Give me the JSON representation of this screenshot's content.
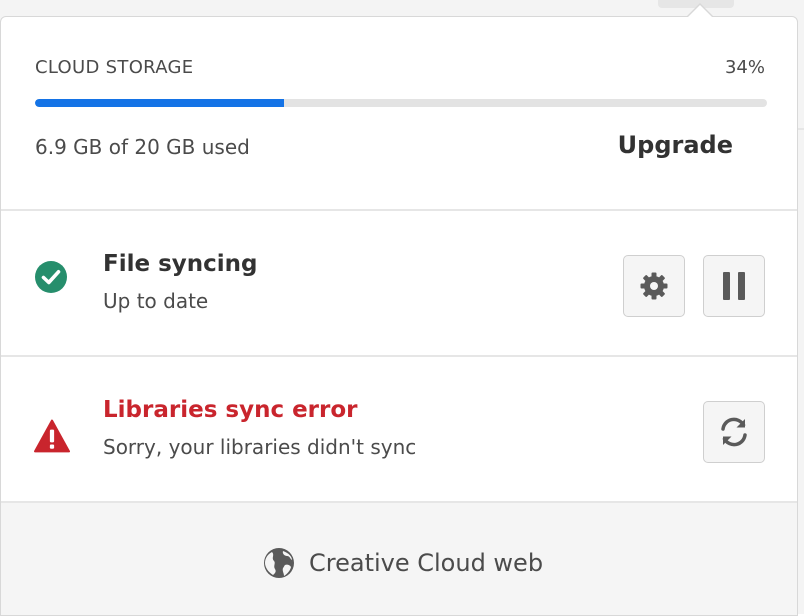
{
  "storage": {
    "title": "CLOUD STORAGE",
    "percent_label": "34%",
    "percent_value": 0.34,
    "used_label": "6.9 GB of 20 GB used",
    "upgrade_label": "Upgrade"
  },
  "file_sync": {
    "title": "File syncing",
    "status": "Up to date",
    "icon": "check-circle-icon"
  },
  "libraries": {
    "title": "Libraries sync error",
    "status": "Sorry, your libraries didn't sync",
    "icon": "alert-triangle-icon"
  },
  "footer": {
    "label": "Creative Cloud web",
    "icon": "globe-icon"
  },
  "colors": {
    "accent": "#1473e6",
    "success": "#268e6c",
    "error": "#c9252d"
  }
}
